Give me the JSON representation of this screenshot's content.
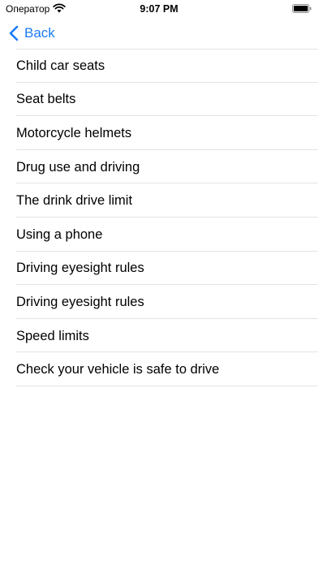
{
  "status_bar": {
    "carrier": "Оператор",
    "time": "9:07 PM",
    "wifi_icon": "wifi-icon",
    "battery_icon": "battery-icon"
  },
  "nav": {
    "back_label": "Back",
    "accent_color": "#1a7cf5"
  },
  "list": {
    "items": [
      {
        "label": "Child car seats"
      },
      {
        "label": "Seat belts"
      },
      {
        "label": "Motorcycle helmets"
      },
      {
        "label": "Drug use and driving"
      },
      {
        "label": "The drink drive limit"
      },
      {
        "label": "Using a phone"
      },
      {
        "label": "Driving eyesight rules"
      },
      {
        "label": "Driving eyesight rules"
      },
      {
        "label": "Speed limits"
      },
      {
        "label": "Check your vehicle is safe to drive"
      }
    ]
  }
}
